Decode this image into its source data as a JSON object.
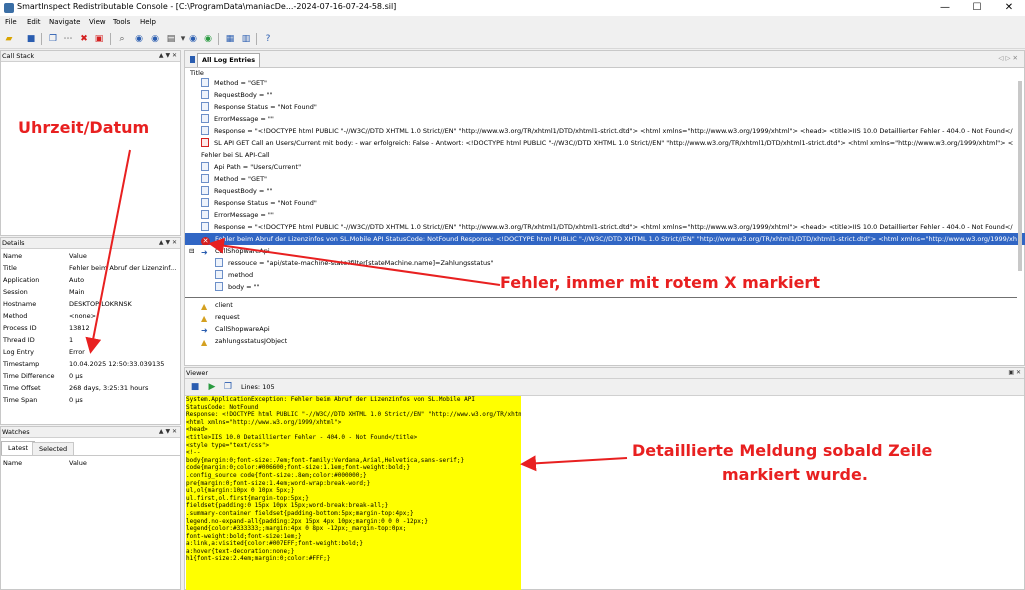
{
  "window": {
    "title": "SmartInspect Redistributable Console - [C:\\ProgramData\\maniacDe...-2024-07-16-07-24-58.sil]",
    "minimize": "—",
    "maximize": "☐",
    "close": "✕"
  },
  "menu": [
    "File",
    "Edit",
    "Navigate",
    "View",
    "Tools",
    "Help"
  ],
  "toolbar_icons": [
    "open-icon",
    "save-icon",
    "copy-icon",
    "dots-icon",
    "delete-icon",
    "clear-icon",
    "find-icon",
    "back-icon",
    "forward-icon",
    "pause-icon",
    "bookmark-icon",
    "play-icon",
    "next-icon",
    "view-icon",
    "layout-icon",
    "help-icon"
  ],
  "callstack": {
    "title": "Call Stack",
    "buttons": "▲ ▼ ✕"
  },
  "details": {
    "title": "Details",
    "buttons": "▲ ▼ ✕",
    "col_name": "Name",
    "col_value": "Value",
    "rows": [
      {
        "name": "Title",
        "value": "Fehler beim Abruf der Lizenzinf..."
      },
      {
        "name": "Application",
        "value": "Auto"
      },
      {
        "name": "Session",
        "value": "Main"
      },
      {
        "name": "Hostname",
        "value": "DESKTOP-LOKRNSK"
      },
      {
        "name": "Method",
        "value": "<none>"
      },
      {
        "name": "Process ID",
        "value": "13812"
      },
      {
        "name": "Thread ID",
        "value": "1"
      },
      {
        "name": "Log Entry",
        "value": "Error"
      },
      {
        "name": "Timestamp",
        "value": "10.04.2025 12:50:33.039135"
      },
      {
        "name": "Time Difference",
        "value": "0 µs"
      },
      {
        "name": "Time Offset",
        "value": "268 days, 3:25:31 hours"
      },
      {
        "name": "Time Span",
        "value": "0 µs"
      }
    ]
  },
  "watches": {
    "title": "Watches",
    "buttons": "▲ ▼ ✕",
    "tabs": [
      "Latest",
      "Selected"
    ],
    "col_name": "Name",
    "col_value": "Value"
  },
  "log": {
    "tab": "All Log Entries",
    "nav": "◁ ▷ ✕",
    "column": "Title",
    "rows": [
      {
        "indent": 0,
        "icon": "msg",
        "text": "Method = \"GET\""
      },
      {
        "indent": 0,
        "icon": "msg",
        "text": "RequestBody = \"\""
      },
      {
        "indent": 0,
        "icon": "msg",
        "text": "Response Status = \"Not Found\""
      },
      {
        "indent": 0,
        "icon": "msg",
        "text": "ErrorMessage = \"\""
      },
      {
        "indent": 0,
        "icon": "msg",
        "text": "Response = \"<!DOCTYPE html PUBLIC \"-//W3C//DTD XHTML 1.0 Strict//EN\" \"http://www.w3.org/TR/xhtml1/DTD/xhtml1-strict.dtd\">  <html xmlns=\"http://www.w3.org/1999/xhtml\">  <head>  <title>IIS 10.0 Detaillierter Fehler - 404.0 - Not Found</"
      },
      {
        "indent": 0,
        "icon": "red",
        "text": "SL API GET Call an Users/Current mit body:  - war erfolgreich: False - Antwort: <!DOCTYPE html PUBLIC \"-//W3C//DTD XHTML 1.0 Strict//EN\" \"http://www.w3.org/TR/xhtml1/DTD/xhtml1-strict.dtd\">  <html xmlns=\"http://www.w3.org/1999/xhtml\">  <"
      },
      {
        "indent": 0,
        "icon": "none",
        "text": "Fehler bei SL API-Call"
      },
      {
        "indent": 0,
        "icon": "msg",
        "text": "Api Path = \"Users/Current\""
      },
      {
        "indent": 0,
        "icon": "msg",
        "text": "Method = \"GET\""
      },
      {
        "indent": 0,
        "icon": "msg",
        "text": "RequestBody = \"\""
      },
      {
        "indent": 0,
        "icon": "msg",
        "text": "Response Status = \"Not Found\""
      },
      {
        "indent": 0,
        "icon": "msg",
        "text": "ErrorMessage = \"\""
      },
      {
        "indent": 0,
        "icon": "msg",
        "text": "Response = \"<!DOCTYPE html PUBLIC \"-//W3C//DTD XHTML 1.0 Strict//EN\" \"http://www.w3.org/TR/xhtml1/DTD/xhtml1-strict.dtd\">  <html xmlns=\"http://www.w3.org/1999/xhtml\">  <head>  <title>IIS 10.0 Detaillierter Fehler - 404.0 - Not Found</"
      },
      {
        "indent": 0,
        "icon": "error",
        "selected": true,
        "text": "Fehler beim Abruf der Lizenzinfos von SL.Mobile API StatusCode: NotFound Response: <!DOCTYPE html PUBLIC \"-//W3C//DTD XHTML 1.0 Strict//EN\" \"http://www.w3.org/TR/xhtml1/DTD/xhtml1-strict.dtd\">  <html xmlns=\"http://www.w3.org/1999/xh"
      },
      {
        "indent": -1,
        "icon": "arrow",
        "text": "CallShopwareApi",
        "expander": "⊟"
      },
      {
        "indent": 1,
        "icon": "msg",
        "text": "ressouce = \"api/state-machine-state?filter[stateMachine.name]=Zahlungsstatus\""
      },
      {
        "indent": 1,
        "icon": "msg",
        "text": "method"
      },
      {
        "indent": 1,
        "icon": "msg",
        "text": "body = \"\""
      },
      {
        "indent": 0,
        "icon": "user",
        "text": "client",
        "gap": true
      },
      {
        "indent": 0,
        "icon": "user",
        "text": "request"
      },
      {
        "indent": -1,
        "icon": "arrow",
        "text": "CallShopwareApi"
      },
      {
        "indent": -1,
        "icon": "user",
        "text": "zahlungsstatusJObject"
      }
    ]
  },
  "viewer": {
    "title": "Viewer",
    "lines": "Lines: 105",
    "code": [
      "System.ApplicationException: Fehler beim Abruf der Lizenzinfos von SL.Mobile API",
      "StatusCode: NotFound",
      "Response: <!DOCTYPE html PUBLIC \"-//W3C//DTD XHTML 1.0 Strict//EN\" \"http://www.w3.org/TR/xhtml1/DTD/xhtml1-strict.dtd\">",
      "<html xmlns=\"http://www.w3.org/1999/xhtml\">",
      "<head>",
      "<title>IIS 10.0 Detaillierter Fehler - 404.0 - Not Found</title>",
      "<style type=\"text/css\">",
      "<!--",
      "body{margin:0;font-size:.7em;font-family:Verdana,Arial,Helvetica,sans-serif;}",
      "code{margin:0;color:#006600;font-size:1.1em;font-weight:bold;}",
      ".config_source code{font-size:.8em;color:#000000;}",
      "pre{margin:0;font-size:1.4em;word-wrap:break-word;}",
      "ul,ol{margin:10px 0 10px 5px;}",
      "ul.first,ol.first{margin-top:5px;}",
      "fieldset{padding:0 15px 10px 15px;word-break:break-all;}",
      ".summary-container fieldset{padding-bottom:5px;margin-top:4px;}",
      "legend.no-expand-all{padding:2px 15px 4px 10px;margin:0 0 0 -12px;}",
      "legend{color:#333333;;margin:4px 0 8px -12px;_margin-top:0px;",
      "font-weight:bold;font-size:1em;}",
      "a:link,a:visited{color:#007EFF;font-weight:bold;}",
      "a:hover{text-decoration:none;}",
      "h1{font-size:2.4em;margin:0;color:#FFF;}"
    ]
  },
  "annotations": {
    "date": "Uhrzeit/Datum",
    "error": "Fehler, immer mit rotem X markiert",
    "detail1": "Detaillierte Meldung sobald Zeile",
    "detail2": "markiert wurde."
  },
  "colors": {
    "selection": "#3166c4",
    "highlight": "#ffff00",
    "annotation": "#e82020"
  }
}
